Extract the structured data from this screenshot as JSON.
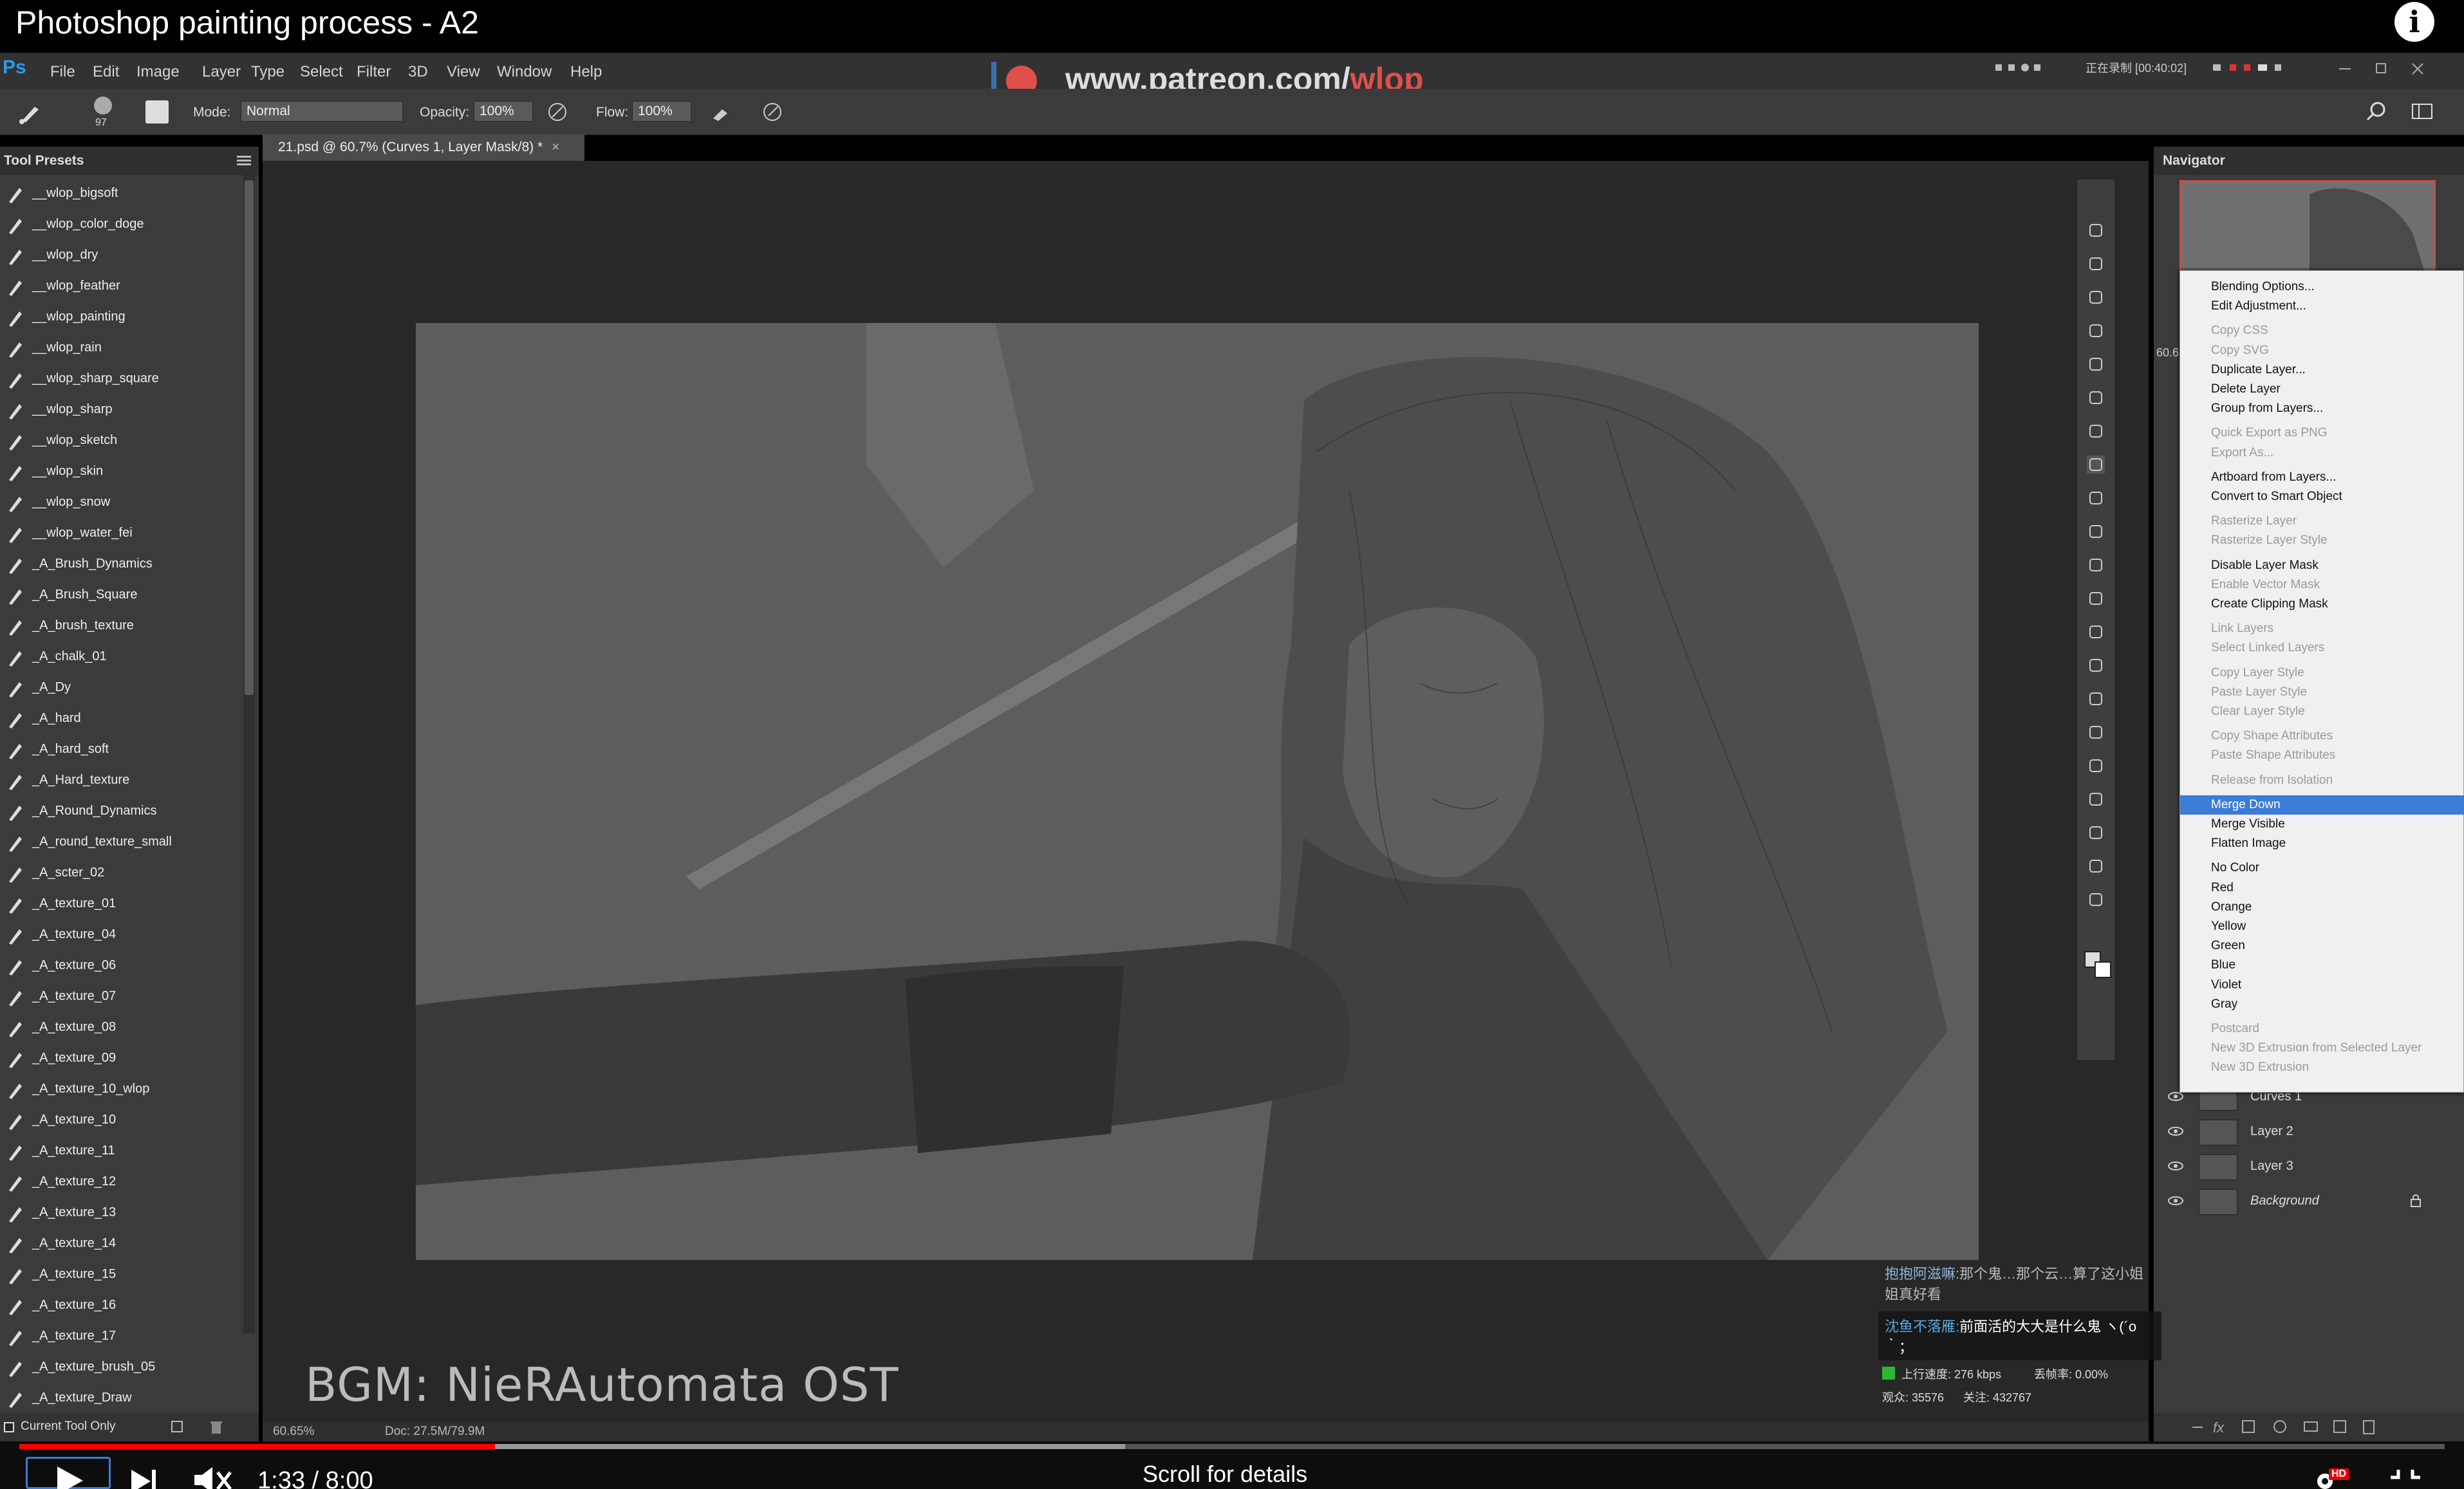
{
  "video": {
    "title": "Photoshop painting process - A2",
    "time": "1:33 / 8:00",
    "scroll_hint": "Scroll for details",
    "progress_played": 0.196,
    "progress_loaded": 0.456,
    "quality_badge": "HD"
  },
  "ps": {
    "logo": "Ps",
    "menu": [
      "File",
      "Edit",
      "Image",
      "Layer",
      "Type",
      "Select",
      "Filter",
      "3D",
      "View",
      "Window",
      "Help"
    ],
    "recording_label": "正在录制 [00:40:02]",
    "watermark": {
      "prefix": "www.patreon.com/",
      "highlight": "wlop"
    },
    "options": {
      "brush_size": "97",
      "mode_label": "Mode:",
      "mode_value": "Normal",
      "opacity_label": "Opacity:",
      "opacity_value": "100%",
      "flow_label": "Flow:",
      "flow_value": "100%"
    },
    "tool_presets": {
      "title": "Tool Presets",
      "footer_label": "Current Tool Only",
      "items": [
        "__wlop_bigsoft",
        "__wlop_color_doge",
        "__wlop_dry",
        "__wlop_feather",
        "__wlop_painting",
        "__wlop_rain",
        "__wlop_sharp_square",
        "__wlop_sharp",
        "__wlop_sketch",
        "__wlop_skin",
        "__wlop_snow",
        "__wlop_water_fei",
        "_A_Brush_Dynamics",
        "_A_Brush_Square",
        "_A_brush_texture",
        "_A_chalk_01",
        "_A_Dy",
        "_A_hard",
        "_A_hard_soft",
        "_A_Hard_texture",
        "_A_Round_Dynamics",
        "_A_round_texture_small",
        "_A_scter_02",
        "_A_texture_01",
        "_A_texture_04",
        "_A_texture_06",
        "_A_texture_07",
        "_A_texture_08",
        "_A_texture_09",
        "_A_texture_10_wlop",
        "_A_texture_10",
        "_A_texture_11",
        "_A_texture_12",
        "_A_texture_13",
        "_A_texture_14",
        "_A_texture_15",
        "_A_texture_16",
        "_A_texture_17",
        "_A_texture_brush_05",
        "_A_texture_Draw"
      ]
    },
    "document_tab": "21.psd @ 60.7% (Curves 1, Layer Mask/8) *",
    "status": {
      "zoom": "60.65%",
      "doc": "Doc: 27.5M/79.9M"
    },
    "bgm": "BGM: NieRAutomata OST",
    "navigator": {
      "title": "Navigator",
      "zoom_partial": "60.6"
    },
    "context_menu": [
      {
        "label": "Blending Options...",
        "enabled": true
      },
      {
        "label": "Edit Adjustment...",
        "enabled": true
      },
      {
        "label": "Copy CSS",
        "enabled": false
      },
      {
        "label": "Copy SVG",
        "enabled": false
      },
      {
        "label": "Duplicate Layer...",
        "enabled": true
      },
      {
        "label": "Delete Layer",
        "enabled": true
      },
      {
        "label": "Group from Layers...",
        "enabled": true
      },
      {
        "label": "Quick Export as PNG",
        "enabled": false
      },
      {
        "label": "Export As...",
        "enabled": false
      },
      {
        "label": "Artboard from Layers...",
        "enabled": true
      },
      {
        "label": "Convert to Smart Object",
        "enabled": true
      },
      {
        "label": "Rasterize Layer",
        "enabled": false
      },
      {
        "label": "Rasterize Layer Style",
        "enabled": false
      },
      {
        "label": "Disable Layer Mask",
        "enabled": true
      },
      {
        "label": "Enable Vector Mask",
        "enabled": false
      },
      {
        "label": "Create Clipping Mask",
        "enabled": true
      },
      {
        "label": "Link Layers",
        "enabled": false
      },
      {
        "label": "Select Linked Layers",
        "enabled": false
      },
      {
        "label": "Copy Layer Style",
        "enabled": false
      },
      {
        "label": "Paste Layer Style",
        "enabled": false
      },
      {
        "label": "Clear Layer Style",
        "enabled": false
      },
      {
        "label": "Copy Shape Attributes",
        "enabled": false
      },
      {
        "label": "Paste Shape Attributes",
        "enabled": false
      },
      {
        "label": "Release from Isolation",
        "enabled": false
      },
      {
        "label": "Merge Down",
        "enabled": true,
        "highlighted": true
      },
      {
        "label": "Merge Visible",
        "enabled": true
      },
      {
        "label": "Flatten Image",
        "enabled": true
      },
      {
        "label": "No Color",
        "enabled": true
      },
      {
        "label": "Red",
        "enabled": true
      },
      {
        "label": "Orange",
        "enabled": true
      },
      {
        "label": "Yellow",
        "enabled": true
      },
      {
        "label": "Green",
        "enabled": true
      },
      {
        "label": "Blue",
        "enabled": true
      },
      {
        "label": "Violet",
        "enabled": true
      },
      {
        "label": "Gray",
        "enabled": true
      },
      {
        "label": "Postcard",
        "enabled": false
      },
      {
        "label": "New 3D Extrusion from Selected Layer",
        "enabled": false
      },
      {
        "label": "New 3D Extrusion",
        "enabled": false
      }
    ],
    "layers": [
      {
        "name": "Curves 1"
      },
      {
        "name": "Layer 2"
      },
      {
        "name": "Layer 3"
      },
      {
        "name": "Background",
        "italic": true,
        "locked": true
      }
    ],
    "chat": [
      {
        "user": "抱抱阿滋嘛:",
        "text": "那个鬼…那个云…算了这小姐姐真好看"
      },
      {
        "user": "沈鱼不落雁:",
        "text": "前面活的大大是什么鬼 ヽ(´o｀；"
      }
    ],
    "stream_stats": {
      "upload": "上行速度: 276 kbps",
      "drop": "丢帧率: 0.00%",
      "line2a": "观众: 35576",
      "line2b": "关注: 432767"
    }
  },
  "colors": {
    "accent_red": "#e0504a",
    "highlight_blue": "#3a7cd6",
    "ps_blue": "#2d9ae8"
  }
}
